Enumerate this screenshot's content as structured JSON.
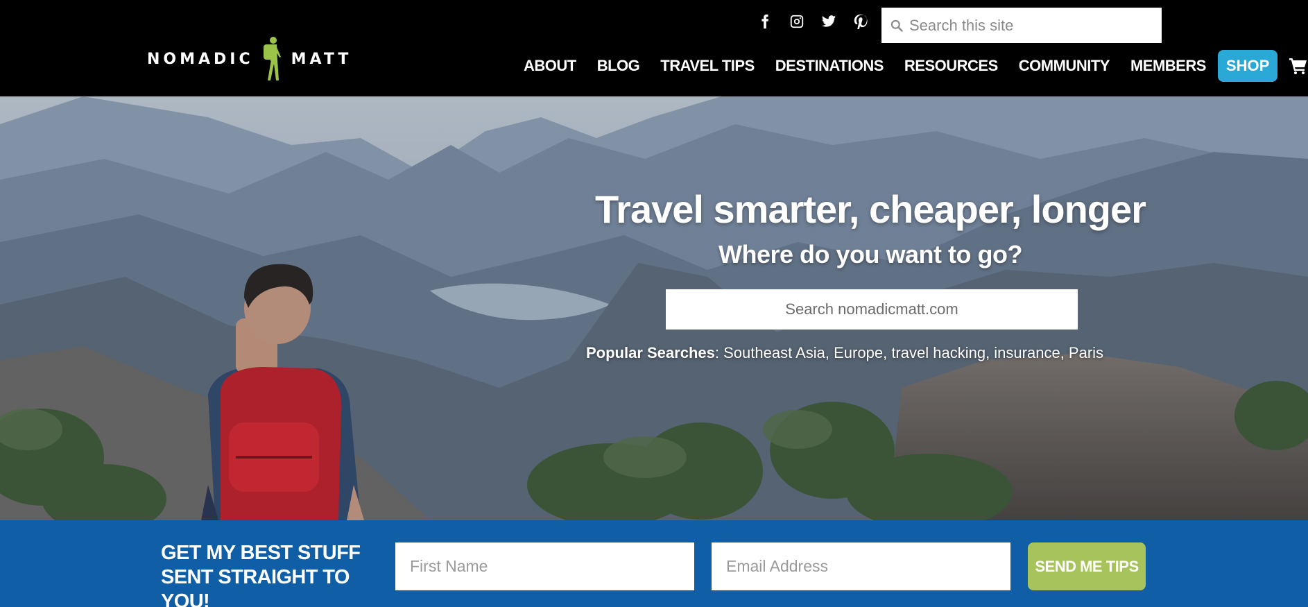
{
  "brand": {
    "logo_left": "NOMADIC",
    "logo_right": "MATT",
    "logo_figure": "backpacker-figure",
    "accent_green": "#9bc34a"
  },
  "header": {
    "social_icons": [
      "facebook-icon",
      "instagram-icon",
      "twitter-icon",
      "pinterest-icon"
    ],
    "search_placeholder": "Search this site",
    "nav": {
      "about": "ABOUT",
      "blog": "BLOG",
      "travel_tips": "TRAVEL TIPS",
      "destinations": "DESTINATIONS",
      "resources": "RESOURCES",
      "community": "COMMUNITY",
      "members": "MEMBERS",
      "shop": "SHOP"
    },
    "cart_icon": "cart-icon",
    "shop_color": "#2aa8d6"
  },
  "hero": {
    "title": "Travel smarter, cheaper, longer",
    "subtitle": "Where do you want to go?",
    "search_placeholder": "Search nomadicmatt.com",
    "popular_label": "Popular Searches",
    "popular_items": [
      "Southeast Asia",
      "Europe",
      "travel hacking",
      "insurance",
      "Paris"
    ]
  },
  "newsletter": {
    "heading": "GET MY BEST STUFF SENT STRAIGHT TO YOU!",
    "first_name_placeholder": "First Name",
    "email_placeholder": "Email Address",
    "submit_label": "SEND ME TIPS",
    "bar_color": "#0f5ea6",
    "submit_color": "#a7c45c"
  }
}
